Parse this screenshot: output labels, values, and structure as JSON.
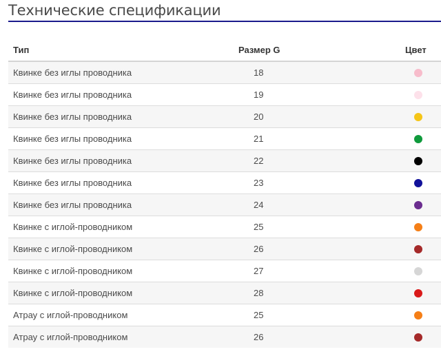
{
  "title": "Технические спецификации",
  "table": {
    "headers": {
      "type": "Тип",
      "size": "Размер G",
      "color": "Цвет"
    },
    "rows": [
      {
        "type": "Квинке без иглы проводника",
        "size": "18",
        "color": "#f7bccb",
        "color_name": "pink"
      },
      {
        "type": "Квинке без иглы проводника",
        "size": "19",
        "color": "#fde1ea",
        "color_name": "light-pink"
      },
      {
        "type": "Квинке без иглы проводника",
        "size": "20",
        "color": "#f5c518",
        "color_name": "yellow"
      },
      {
        "type": "Квинке без иглы проводника",
        "size": "21",
        "color": "#0f9a3c",
        "color_name": "green"
      },
      {
        "type": "Квинке без иглы проводника",
        "size": "22",
        "color": "#000000",
        "color_name": "black"
      },
      {
        "type": "Квинке без иглы проводника",
        "size": "23",
        "color": "#12129a",
        "color_name": "dark-blue"
      },
      {
        "type": "Квинке без иглы проводника",
        "size": "24",
        "color": "#6b2d8f",
        "color_name": "purple"
      },
      {
        "type": "Квинке с иглой-проводником",
        "size": "25",
        "color": "#f57f17",
        "color_name": "orange"
      },
      {
        "type": "Квинке с иглой-проводником",
        "size": "26",
        "color": "#a52a2a",
        "color_name": "brown"
      },
      {
        "type": "Квинке с иглой-проводником",
        "size": "27",
        "color": "#d6d6d6",
        "color_name": "grey"
      },
      {
        "type": "Квинке с иглой-проводником",
        "size": "28",
        "color": "#d91a1a",
        "color_name": "red"
      },
      {
        "type": "Атрау с иглой-проводником",
        "size": "25",
        "color": "#f57f17",
        "color_name": "orange"
      },
      {
        "type": "Атрау с иглой-проводником",
        "size": "26",
        "color": "#a52a2a",
        "color_name": "brown"
      }
    ]
  }
}
